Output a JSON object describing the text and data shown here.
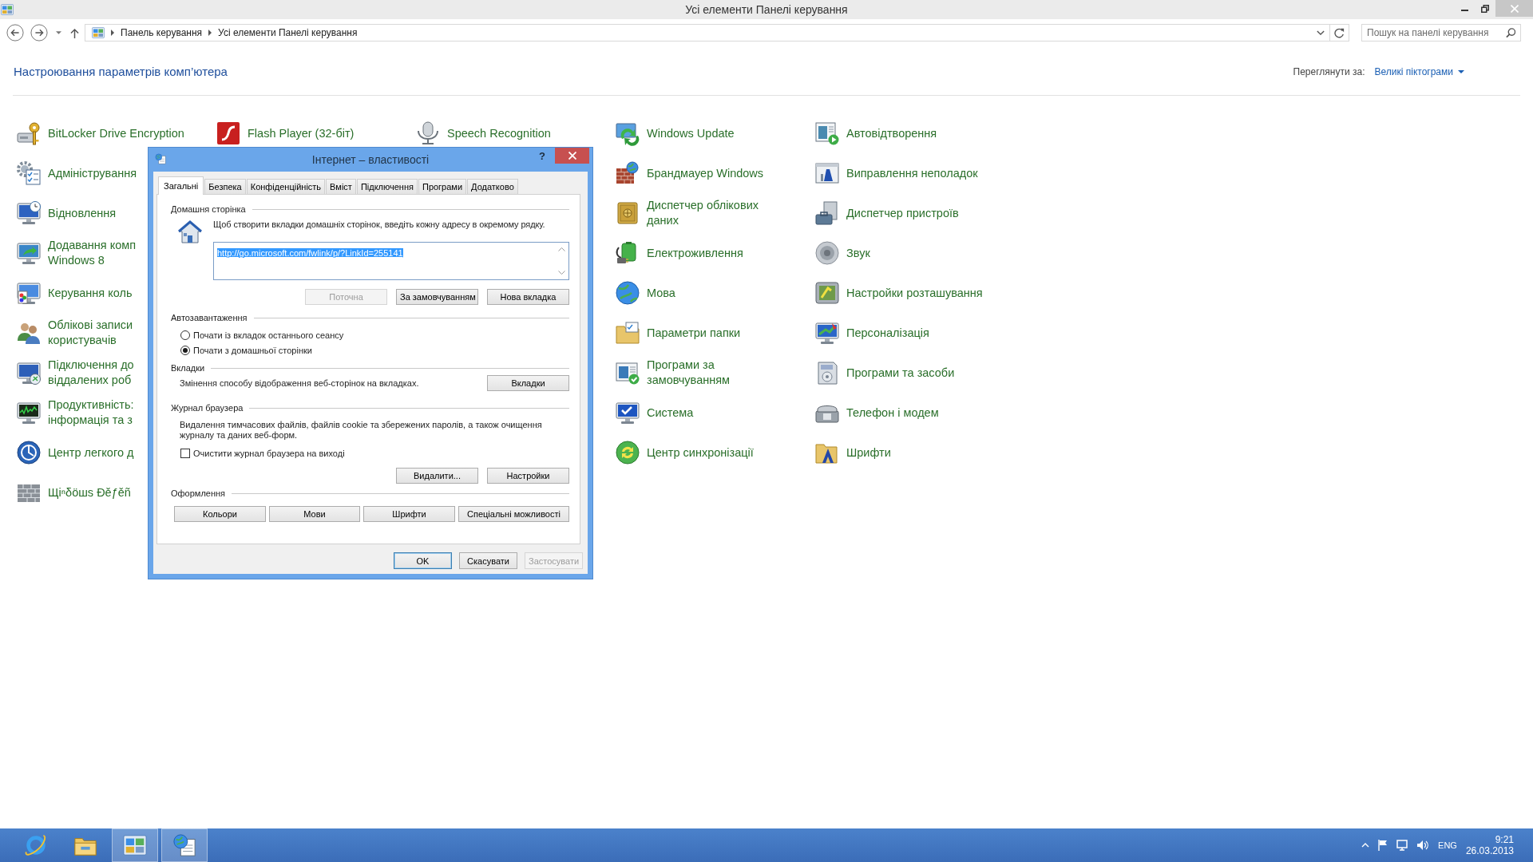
{
  "window": {
    "title": "Усі елементи Панелі керування"
  },
  "address_bar": {
    "breadcrumbs": [
      "Панель керування",
      "Усі елементи Панелі керування"
    ]
  },
  "search": {
    "placeholder": "Пошук на панелі керування"
  },
  "header": {
    "title": "Настроювання параметрів комп’ютера",
    "view_label": "Переглянути за:",
    "view_value": "Великі піктограми"
  },
  "columns": [
    {
      "items": [
        {
          "lines": [
            "BitLocker Drive Encryption"
          ]
        },
        {
          "lines": [
            "Адміністрування"
          ]
        },
        {
          "lines": [
            "Відновлення"
          ]
        },
        {
          "lines": [
            "Додавання комп",
            "Windows 8"
          ]
        },
        {
          "lines": [
            "Керування коль"
          ]
        },
        {
          "lines": [
            "Облікові записи",
            "користувачів"
          ]
        },
        {
          "lines": [
            "Підключення до",
            "віддалених роб"
          ]
        },
        {
          "lines": [
            "Продуктивність:",
            "інформація та з"
          ]
        },
        {
          "lines": [
            "Центр легкого д"
          ]
        },
        {
          "lines": [
            "Щіⁿδöшѕ Ðěƒěñ"
          ]
        }
      ]
    },
    {
      "items": [
        {
          "lines": [
            "Flash Player (32-біт)"
          ]
        }
      ]
    },
    {
      "items": [
        {
          "lines": [
            "Speech Recognition"
          ]
        }
      ]
    },
    {
      "items": [
        {
          "lines": [
            "Windows Update"
          ]
        },
        {
          "lines": [
            "Брандмауер Windows"
          ]
        },
        {
          "lines": [
            "Диспетчер облікових",
            "даних"
          ]
        },
        {
          "lines": [
            "Електроживлення"
          ]
        },
        {
          "lines": [
            "Мова"
          ]
        },
        {
          "lines": [
            "Параметри папки"
          ]
        },
        {
          "lines": [
            "Програми за",
            "замовчуванням"
          ]
        },
        {
          "lines": [
            "Система"
          ]
        },
        {
          "lines": [
            "Центр синхронізації"
          ]
        }
      ]
    },
    {
      "items": [
        {
          "lines": [
            "Автовідтворення"
          ]
        },
        {
          "lines": [
            "Виправлення неполадок"
          ]
        },
        {
          "lines": [
            "Диспетчер пристроїв"
          ]
        },
        {
          "lines": [
            "Звук"
          ]
        },
        {
          "lines": [
            "Настройки розташування"
          ]
        },
        {
          "lines": [
            "Персоналізація"
          ]
        },
        {
          "lines": [
            "Програми та засоби"
          ]
        },
        {
          "lines": [
            "Телефон і модем"
          ]
        },
        {
          "lines": [
            "Шрифти"
          ]
        }
      ]
    }
  ],
  "dialog": {
    "title": "Інтернет – властивості",
    "help": "?",
    "tabs": [
      {
        "label": "Загальні",
        "selected": true
      },
      {
        "label": "Безпека",
        "selected": false
      },
      {
        "label": "Конфіденційність",
        "selected": false
      },
      {
        "label": "Вміст",
        "selected": false
      },
      {
        "label": "Підключення",
        "selected": false
      },
      {
        "label": "Програми",
        "selected": false
      },
      {
        "label": "Додатково",
        "selected": false
      }
    ],
    "home_page": {
      "heading": "Домашня сторінка",
      "hint": "Щоб створити вкладки домашніх сторінок, введіть кожну адресу в окремому рядку.",
      "value": "http://go.microsoft.com/fwlink/p/?LinkId=255141",
      "value_selected": true,
      "buttons": [
        {
          "label": "Поточна",
          "disabled": true
        },
        {
          "label": "За замовчуванням",
          "disabled": false
        },
        {
          "label": "Нова вкладка",
          "disabled": false
        }
      ]
    },
    "startup": {
      "heading": "Автозавантаження",
      "options": [
        {
          "label": "Почати із вкладок останнього сеансу",
          "selected": false
        },
        {
          "label": "Почати з домашньої сторінки",
          "selected": true
        }
      ]
    },
    "tabs_settings": {
      "heading": "Вкладки",
      "description": "Змінення способу відображення веб-сторінок на вкладках.",
      "button": {
        "label": "Вкладки",
        "disabled": false
      }
    },
    "history": {
      "heading": "Журнал браузера",
      "description": "Видалення тимчасових файлів, файлів cookie та збережених паролів, а також очищення журналу та даних веб-форм.",
      "checkbox": {
        "label": "Очистити журнал браузера на виході",
        "checked": false
      },
      "buttons": [
        {
          "label": "Видалити...",
          "disabled": false
        },
        {
          "label": "Настройки",
          "disabled": false
        }
      ]
    },
    "appearance": {
      "heading": "Оформлення",
      "buttons": [
        {
          "label": "Кольори",
          "disabled": false
        },
        {
          "label": "Мови",
          "disabled": false
        },
        {
          "label": "Шрифти",
          "disabled": false
        },
        {
          "label": "Спеціальні можливості",
          "disabled": false
        }
      ]
    },
    "footer_buttons": [
      {
        "label": "OK",
        "disabled": false,
        "default": true
      },
      {
        "label": "Скасувати",
        "disabled": false,
        "default": false
      },
      {
        "label": "Застосувати",
        "disabled": true,
        "default": false
      }
    ]
  },
  "taskbar": {
    "apps": [
      {
        "open": false
      },
      {
        "open": false
      },
      {
        "open": true
      },
      {
        "open": true
      }
    ],
    "tray": {
      "language": "ENG",
      "time": "9:21",
      "date": "26.03.2013"
    }
  }
}
